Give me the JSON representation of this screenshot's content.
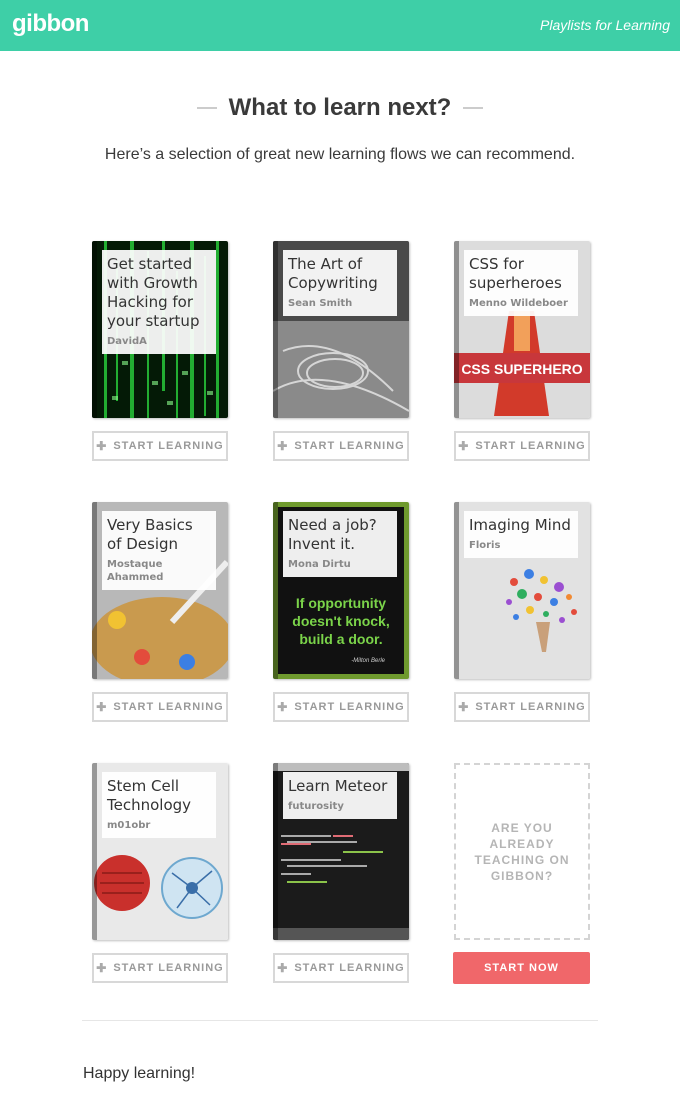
{
  "header": {
    "logo": "gibbon",
    "tagline": "Playlists for Learning"
  },
  "intro": {
    "title": "What to learn next?",
    "subtitle": "Here’s a selection of great new learning flows we can recommend."
  },
  "cards": [
    {
      "title": "Get started with Growth Hacking for your startup",
      "author": "DavidA",
      "button": "START LEARNING"
    },
    {
      "title": "The Art of Copywriting",
      "author": "Sean Smith",
      "button": "START LEARNING"
    },
    {
      "title": "CSS for superheroes",
      "author": "Menno Wildeboer",
      "button": "START LEARNING",
      "cover_text": "CSS SUPERHERO"
    },
    {
      "title": "Very Basics of Design",
      "author": "Mostaque Ahammed",
      "button": "START LEARNING"
    },
    {
      "title": "Need a job? Invent it.",
      "author": "Mona Dirtu",
      "button": "START LEARNING",
      "cover_text": "If opportunity doesn't knock, build a door.",
      "cover_credit": "-Milton Berle"
    },
    {
      "title": "Imaging Mind",
      "author": "Floris",
      "button": "START LEARNING"
    },
    {
      "title": "Stem Cell Technology",
      "author": "m01obr",
      "button": "START LEARNING"
    },
    {
      "title": "Learn Meteor",
      "author": "futurosity",
      "button": "START LEARNING"
    }
  ],
  "teach": {
    "text": "ARE YOU ALREADY TEACHING ON GIBBON?",
    "button": "START NOW"
  },
  "footer": {
    "text": "Happy learning!"
  },
  "colors": {
    "brand": "#3ecfa7",
    "cta": "#f0676a"
  }
}
